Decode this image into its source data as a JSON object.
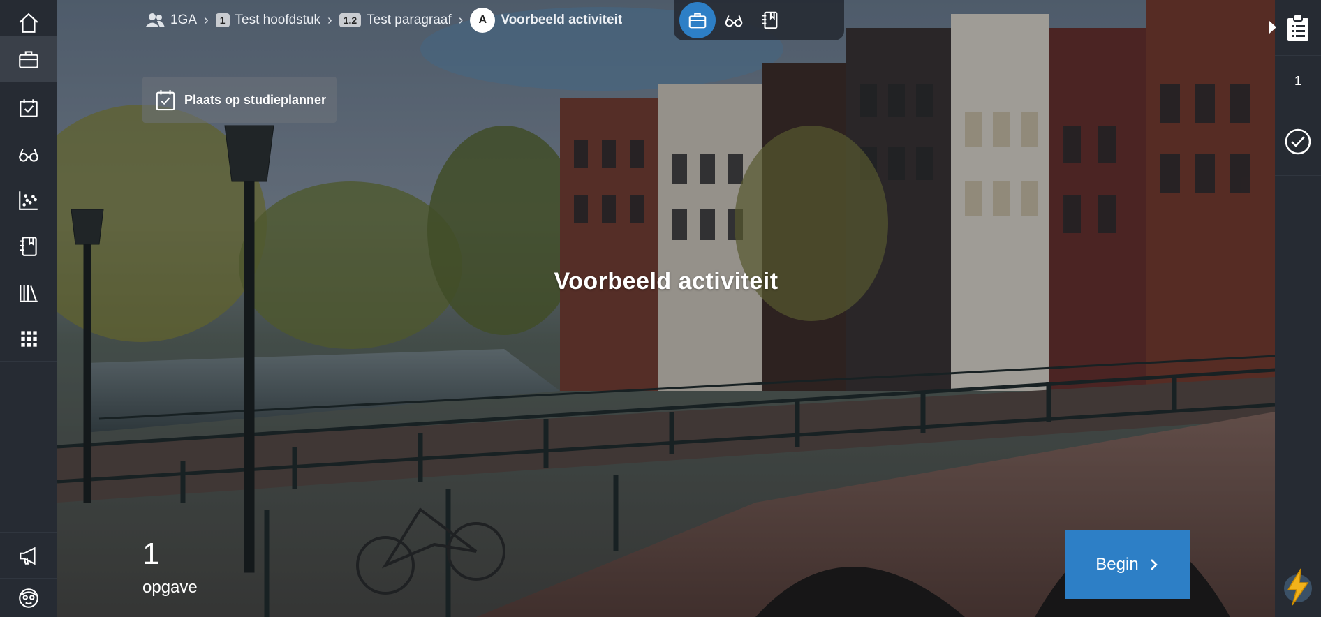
{
  "colors": {
    "sidebar_bg": "#262b33",
    "sidebar_active": "#3a4049",
    "accent_blue": "#2d7fc6",
    "overlay": "rgba(10,14,22,0.32)"
  },
  "sidebar": {
    "items": [
      {
        "icon": "home-icon",
        "active": false
      },
      {
        "icon": "briefcase-icon",
        "active": true
      },
      {
        "icon": "calendar-check-icon",
        "active": false
      },
      {
        "icon": "glasses-icon",
        "active": false
      },
      {
        "icon": "scatter-chart-icon",
        "active": false
      },
      {
        "icon": "book-bookmark-icon",
        "active": false
      },
      {
        "icon": "library-icon",
        "active": false
      },
      {
        "icon": "grid-icon",
        "active": false
      }
    ],
    "bottom_items": [
      {
        "icon": "megaphone-icon"
      },
      {
        "icon": "user-avatar-icon"
      }
    ]
  },
  "breadcrumb": {
    "group": {
      "icon": "users-icon",
      "label": "1GA"
    },
    "chapter": {
      "badge": "1",
      "label": "Test hoofdstuk"
    },
    "paragraph": {
      "badge": "1.2",
      "label": "Test paragraaf"
    },
    "activity": {
      "badge": "A",
      "label": "Voorbeeld activiteit"
    }
  },
  "mode_switch": [
    {
      "icon": "briefcase-icon",
      "active": true
    },
    {
      "icon": "glasses-icon",
      "active": false
    },
    {
      "icon": "book-bookmark-icon",
      "active": false
    }
  ],
  "planner_button": {
    "label": "Plaats op studieplanner",
    "icon": "calendar-check-icon"
  },
  "hero": {
    "title": "Voorbeeld activiteit",
    "task_count": "1",
    "task_label": "opgave",
    "begin_label": "Begin"
  },
  "right_panel": {
    "clipboard_icon": "clipboard-icon",
    "count": "1",
    "check_icon": "check-circle-icon",
    "bolt_icon": "lightning-icon"
  }
}
